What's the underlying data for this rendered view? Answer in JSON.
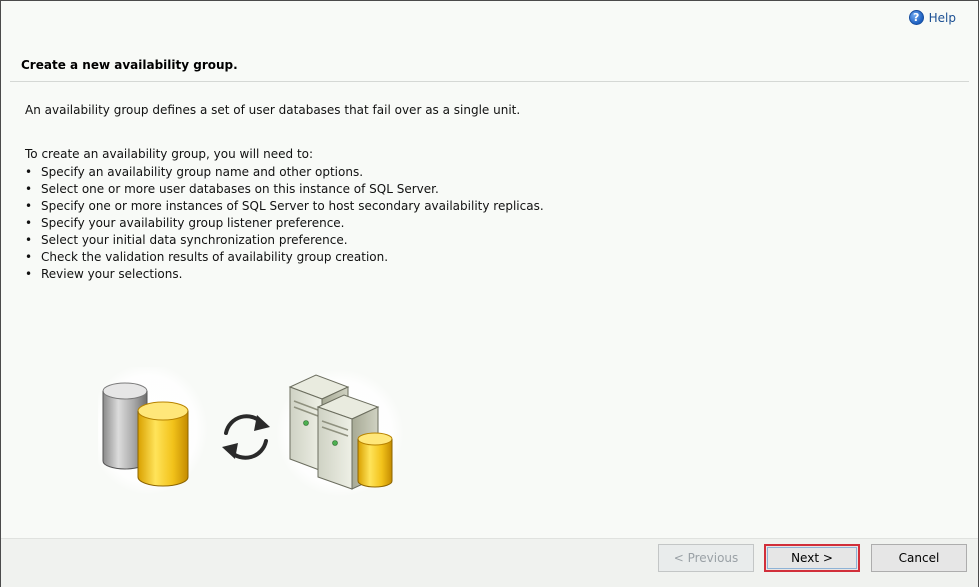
{
  "header": {
    "help_label": "Help",
    "help_icon": "question-circle-icon"
  },
  "main": {
    "heading": "Create a new availability group.",
    "description": "An availability group defines a set of user databases that fail over as a single unit.",
    "intro": "To create an availability group, you will need to:",
    "bullet_char": "•",
    "steps": [
      "Specify an availability group name and other options.",
      "Select one or more user databases on this instance of SQL Server.",
      "Specify one or more instances of SQL Server to host secondary availability replicas.",
      "Specify your availability group listener preference.",
      "Select your initial data synchronization preference.",
      "Check the validation results of availability group creation.",
      "Review your selections."
    ],
    "illustration": {
      "left_icon": "database-cylinders-icon",
      "middle_icon": "sync-arrows-icon",
      "right_icon": "servers-database-icon"
    }
  },
  "footer": {
    "previous_label": "< Previous",
    "next_label": "Next >",
    "cancel_label": "Cancel"
  },
  "colors": {
    "accent_focus": "#d12f3a",
    "disabled_text": "#9aa1a6",
    "database_gold": "#f2c21a"
  }
}
